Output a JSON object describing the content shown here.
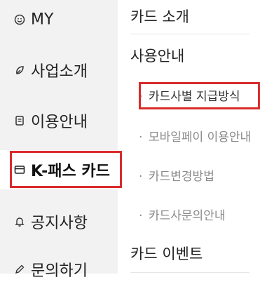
{
  "sidebar": {
    "items": [
      {
        "label": "MY",
        "icon": "smiley-icon"
      },
      {
        "label": "사업소개",
        "icon": "leaf-icon"
      },
      {
        "label": "이용안내",
        "icon": "document-icon"
      },
      {
        "label": "K-패스 카드",
        "icon": "card-icon",
        "active": true
      },
      {
        "label": "공지사항",
        "icon": "bell-icon"
      },
      {
        "label": "문의하기",
        "icon": "pencil-icon"
      }
    ]
  },
  "content": {
    "sections": [
      {
        "title": "카드 소개"
      },
      {
        "title": "사용안내"
      }
    ],
    "sub_items": [
      {
        "bullet": "·",
        "label": "카드사별 지급방식",
        "active": true
      },
      {
        "bullet": "·",
        "label": "모바일페이 이용안내"
      },
      {
        "bullet": "·",
        "label": "카드변경방법"
      },
      {
        "bullet": "·",
        "label": "카드사문의안내"
      }
    ],
    "event_title": "카드 이벤트"
  },
  "colors": {
    "highlight_border": "#d92b2b",
    "sidebar_bg": "#f2f2f2",
    "sub_text": "#8a8a8a"
  }
}
